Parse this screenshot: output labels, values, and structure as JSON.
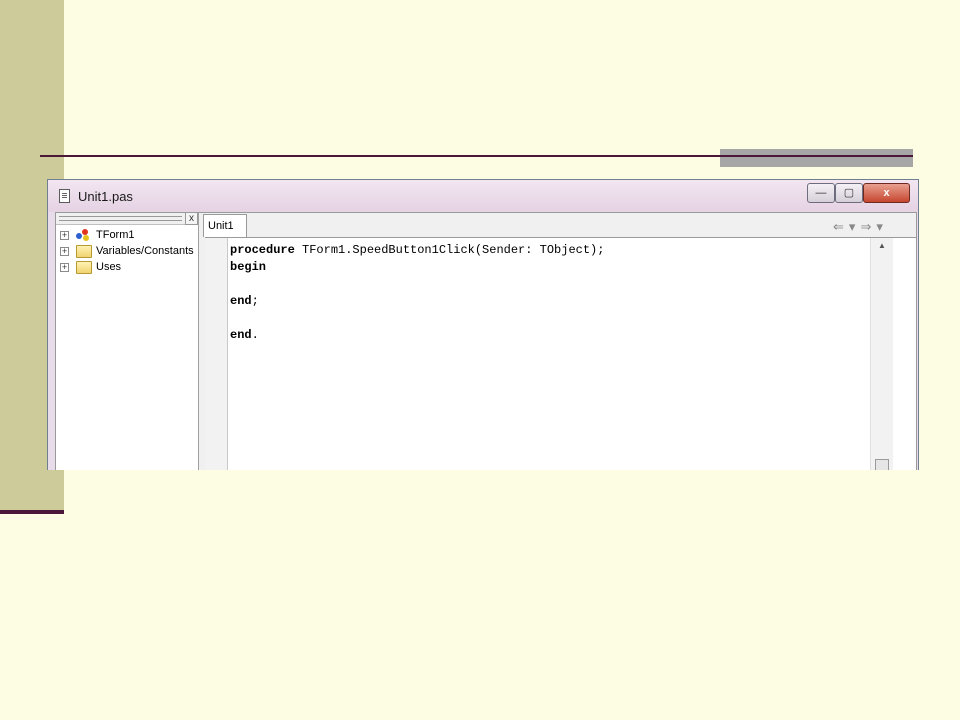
{
  "window": {
    "title": "Unit1.pas",
    "buttons": {
      "minimize": "—",
      "maximize": "▢",
      "close": "x"
    }
  },
  "tree": {
    "close_glyph": "x",
    "items": [
      {
        "label": "TForm1",
        "expander": "+",
        "icon": "form-icon"
      },
      {
        "label": "Variables/Constants",
        "expander": "+",
        "icon": "folder-icon"
      },
      {
        "label": "Uses",
        "expander": "+",
        "icon": "folder-icon"
      }
    ]
  },
  "editor": {
    "tab_label": "Unit1",
    "nav": {
      "back": "⇐",
      "back_drop": "▾",
      "forward": "⇒",
      "forward_drop": "▾"
    },
    "code_lines": [
      {
        "kw": "procedure",
        "rest": " TForm1.SpeedButton1Click(Sender: TObject);"
      },
      {
        "kw": "begin",
        "rest": ""
      },
      {
        "kw": "",
        "rest": ""
      },
      {
        "kw": "end",
        "rest": ";"
      },
      {
        "kw": "",
        "rest": ""
      },
      {
        "kw": "end",
        "rest": "."
      }
    ],
    "scroll_up_glyph": "▲"
  },
  "colors": {
    "slide_background": "#fdfde3",
    "left_bar": "#cdcb9a",
    "accent_line": "#4a1738",
    "rule_block": "#a6a6a6"
  }
}
